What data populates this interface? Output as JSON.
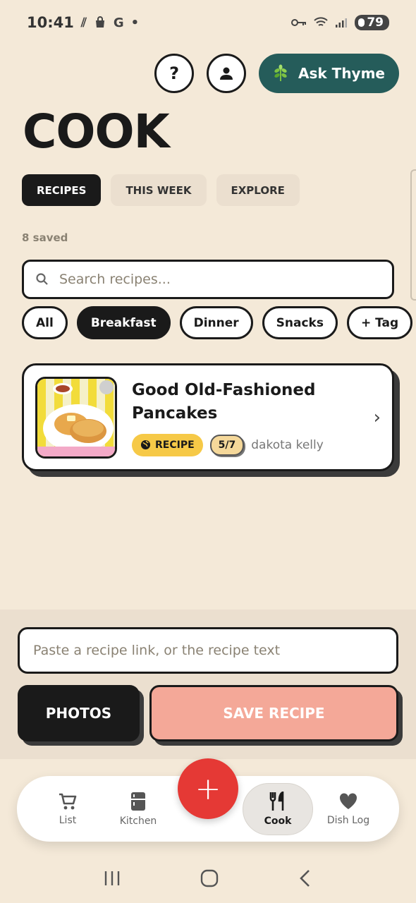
{
  "status_bar": {
    "time": "10:41",
    "battery": "79"
  },
  "header": {
    "help_label": "?",
    "ask_label": "Ask Thyme"
  },
  "page_title": "COOK",
  "tabs": [
    {
      "label": "RECIPES",
      "active": true
    },
    {
      "label": "THIS WEEK",
      "active": false
    },
    {
      "label": "EXPLORE",
      "active": false
    }
  ],
  "saved_count": "8 saved",
  "search": {
    "placeholder": "Search recipes..."
  },
  "filter_chips": [
    {
      "label": "All",
      "active": false
    },
    {
      "label": "Breakfast",
      "active": true
    },
    {
      "label": "Dinner",
      "active": false
    },
    {
      "label": "Snacks",
      "active": false
    },
    {
      "label": "+ Tag",
      "active": false
    }
  ],
  "recipes": [
    {
      "title": "Good Old-Fashioned Pancakes",
      "badge": "RECIPE",
      "score": "5/7",
      "author": "dakota kelly"
    }
  ],
  "import": {
    "placeholder": "Paste a recipe link, or the recipe text",
    "photos_label": "PHOTOS",
    "save_label": "SAVE RECIPE"
  },
  "bottom_nav": {
    "fab_label": "+",
    "items": [
      {
        "label": "List",
        "icon": "cart-icon"
      },
      {
        "label": "Kitchen",
        "icon": "fridge-icon"
      },
      {
        "label": "Cook",
        "icon": "utensils-icon",
        "active": true
      },
      {
        "label": "Dish Log",
        "icon": "heart-icon"
      }
    ]
  },
  "colors": {
    "background": "#f4e9d8",
    "accent_teal": "#255c5a",
    "fab_red": "#e53935",
    "badge_yellow": "#f6c947",
    "save_salmon": "#f4a898"
  }
}
